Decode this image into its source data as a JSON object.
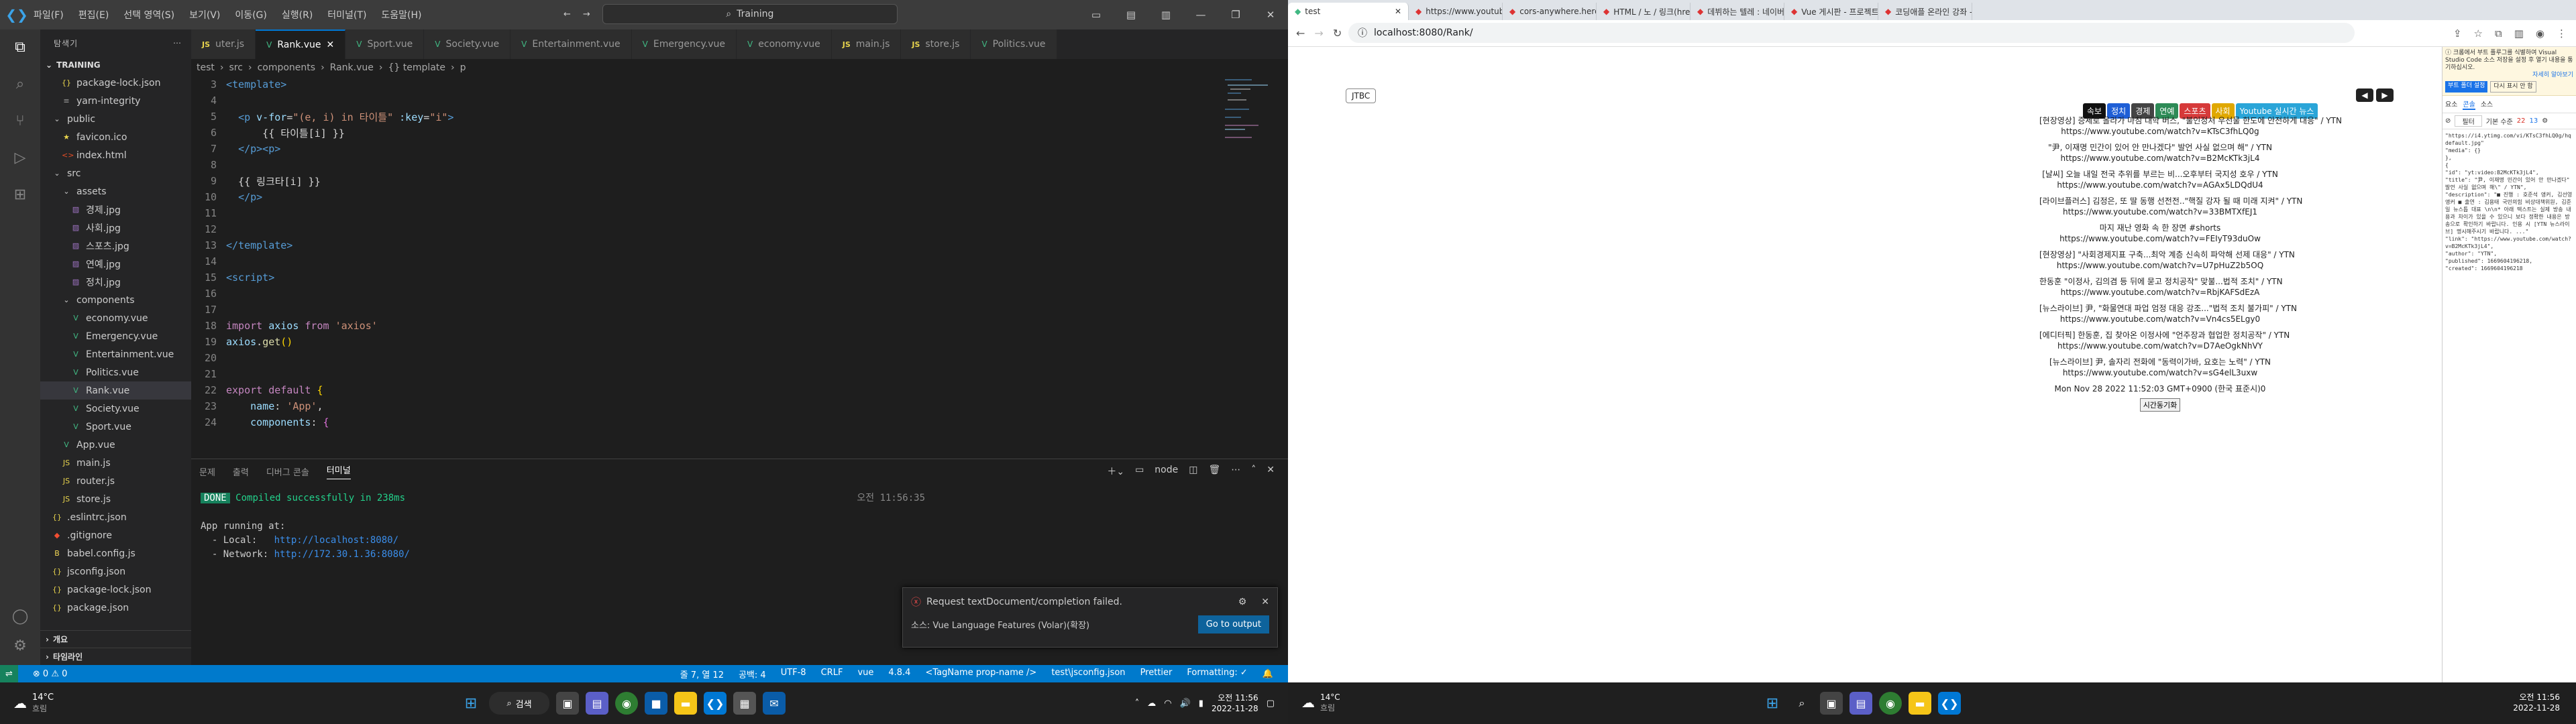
{
  "vscode": {
    "menu": [
      "파일(F)",
      "편집(E)",
      "선택 영역(S)",
      "보기(V)",
      "이동(G)",
      "실행(R)",
      "터미널(T)",
      "도움말(H)"
    ],
    "search_text": "Training",
    "sidebar": {
      "title": "탐색기",
      "section": "TRAINING",
      "items": [
        {
          "label": "package-lock.json",
          "icon": "json",
          "depth": 1
        },
        {
          "label": "yarn-integrity",
          "icon": "file",
          "depth": 1
        },
        {
          "label": "public",
          "icon": "folder",
          "depth": 0
        },
        {
          "label": "favicon.ico",
          "icon": "star",
          "depth": 1
        },
        {
          "label": "index.html",
          "icon": "html",
          "depth": 1
        },
        {
          "label": "src",
          "icon": "folder",
          "depth": 0
        },
        {
          "label": "assets",
          "icon": "folder",
          "depth": 1
        },
        {
          "label": "경제.jpg",
          "icon": "img",
          "depth": 2
        },
        {
          "label": "사회.jpg",
          "icon": "img",
          "depth": 2
        },
        {
          "label": "스포츠.jpg",
          "icon": "img",
          "depth": 2
        },
        {
          "label": "연예.jpg",
          "icon": "img",
          "depth": 2
        },
        {
          "label": "정치.jpg",
          "icon": "img",
          "depth": 2
        },
        {
          "label": "components",
          "icon": "folder",
          "depth": 1
        },
        {
          "label": "economy.vue",
          "icon": "vue",
          "depth": 2
        },
        {
          "label": "Emergency.vue",
          "icon": "vue",
          "depth": 2
        },
        {
          "label": "Entertainment.vue",
          "icon": "vue",
          "depth": 2
        },
        {
          "label": "Politics.vue",
          "icon": "vue",
          "depth": 2
        },
        {
          "label": "Rank.vue",
          "icon": "vue",
          "depth": 2,
          "selected": true
        },
        {
          "label": "Society.vue",
          "icon": "vue",
          "depth": 2
        },
        {
          "label": "Sport.vue",
          "icon": "vue",
          "depth": 2
        },
        {
          "label": "App.vue",
          "icon": "vue",
          "depth": 1
        },
        {
          "label": "main.js",
          "icon": "js",
          "depth": 1
        },
        {
          "label": "router.js",
          "icon": "js",
          "depth": 1
        },
        {
          "label": "store.js",
          "icon": "js",
          "depth": 1
        },
        {
          "label": ".eslintrc.json",
          "icon": "json",
          "depth": 0
        },
        {
          "label": ".gitignore",
          "icon": "git",
          "depth": 0
        },
        {
          "label": "babel.config.js",
          "icon": "babel",
          "depth": 0
        },
        {
          "label": "jsconfig.json",
          "icon": "json",
          "depth": 0
        },
        {
          "label": "package-lock.json",
          "icon": "json",
          "depth": 0
        },
        {
          "label": "package.json",
          "icon": "json",
          "depth": 0
        }
      ],
      "outline": "개요",
      "timeline": "타임라인"
    },
    "tabs": [
      {
        "label": "uter.js",
        "icon": "js"
      },
      {
        "label": "Rank.vue",
        "icon": "vue",
        "active": true
      },
      {
        "label": "Sport.vue",
        "icon": "vue"
      },
      {
        "label": "Society.vue",
        "icon": "vue"
      },
      {
        "label": "Entertainment.vue",
        "icon": "vue"
      },
      {
        "label": "Emergency.vue",
        "icon": "vue"
      },
      {
        "label": "economy.vue",
        "icon": "vue"
      },
      {
        "label": "main.js",
        "icon": "js"
      },
      {
        "label": "store.js",
        "icon": "js"
      },
      {
        "label": "Politics.vue",
        "icon": "vue"
      }
    ],
    "breadcrumb": [
      "test",
      "src",
      "components",
      "Rank.vue",
      "{} template",
      "p"
    ],
    "code_lines": [
      {
        "n": "3",
        "tokens": [
          [
            "tg",
            "<template>"
          ]
        ]
      },
      {
        "n": "4",
        "tokens": []
      },
      {
        "n": "5",
        "tokens": [
          [
            "",
            "  "
          ],
          [
            "tg",
            "<p "
          ],
          [
            "at",
            "v-for"
          ],
          [
            "",
            "="
          ],
          [
            "st",
            "\"(e, i) in 타이틀\" "
          ],
          [
            "at",
            ":key"
          ],
          [
            "",
            "="
          ],
          [
            "st",
            "\"i\""
          ],
          [
            "tg",
            ">"
          ]
        ]
      },
      {
        "n": "6",
        "tokens": [
          [
            "",
            "      {{ 타이틀[i] }}"
          ]
        ]
      },
      {
        "n": "7",
        "tokens": [
          [
            "",
            "  "
          ],
          [
            "tg",
            "</p><p>"
          ]
        ]
      },
      {
        "n": "8",
        "tokens": []
      },
      {
        "n": "9",
        "tokens": [
          [
            "",
            "  {{ 링크타[i] }}"
          ]
        ]
      },
      {
        "n": "10",
        "tokens": [
          [
            "",
            "  "
          ],
          [
            "tg",
            "</p>"
          ]
        ]
      },
      {
        "n": "11",
        "tokens": []
      },
      {
        "n": "12",
        "tokens": []
      },
      {
        "n": "13",
        "tokens": [
          [
            "tg",
            "</template>"
          ]
        ]
      },
      {
        "n": "14",
        "tokens": []
      },
      {
        "n": "15",
        "tokens": [
          [
            "tg",
            "<script>"
          ]
        ]
      },
      {
        "n": "16",
        "tokens": []
      },
      {
        "n": "17",
        "tokens": []
      },
      {
        "n": "18",
        "tokens": [
          [
            "kw",
            "import "
          ],
          [
            "at",
            "axios "
          ],
          [
            "kw",
            "from "
          ],
          [
            "st",
            "'axios'"
          ]
        ]
      },
      {
        "n": "19",
        "tokens": [
          [
            "at",
            "axios"
          ],
          [
            "",
            "."
          ],
          [
            "yl",
            "get"
          ],
          [
            "br",
            "()"
          ]
        ]
      },
      {
        "n": "20",
        "tokens": []
      },
      {
        "n": "21",
        "tokens": []
      },
      {
        "n": "22",
        "tokens": [
          [
            "kw",
            "export default "
          ],
          [
            "br",
            "{"
          ]
        ]
      },
      {
        "n": "23",
        "tokens": [
          [
            "at",
            "    name"
          ],
          [
            "",
            ": "
          ],
          [
            "st",
            "'App'"
          ],
          [
            "",
            ","
          ]
        ]
      },
      {
        "n": "24",
        "tokens": [
          [
            "at",
            "    components"
          ],
          [
            "",
            ": "
          ],
          [
            "pu",
            "{"
          ]
        ]
      }
    ],
    "panel_tabs": [
      "문제",
      "출력",
      "디버그 콘솔",
      "터미널"
    ],
    "panel_active": "터미널",
    "panel_right": "node",
    "terminal": {
      "done_badge": "DONE",
      "compiled": "Compiled successfully in 238ms",
      "time": "오전 11:56:35",
      "running": "App running at:",
      "local_label": "  - Local:   ",
      "local_url": "http://localhost:8080/",
      "network_label": "  - Network: ",
      "network_url": "http://172.30.1.36:8080/"
    },
    "notification": {
      "message": "Request textDocument/completion failed.",
      "source": "소스: Vue Language Features (Volar)(확장)",
      "button": "Go to output"
    },
    "statusbar": {
      "left": [
        "⊗ 0 ⚠ 0"
      ],
      "right": [
        "줄 7, 열 12",
        "공백: 4",
        "UTF-8",
        "CRLF",
        "vue",
        "4.8.4",
        "<TagName prop-name />",
        "test\\jsconfig.json",
        "Prettier",
        "Formatting: ✓"
      ]
    }
  },
  "taskbar1": {
    "weather_temp": "14°C",
    "weather_desc": "흐림",
    "search": "검색",
    "time": "오전 11:56",
    "date": "2022-11-28"
  },
  "browser": {
    "tabs": [
      {
        "label": "test",
        "active": true
      },
      {
        "label": "https://www.youtube.com/feed/..."
      },
      {
        "label": "cors-anywhere.herokuapp.com"
      },
      {
        "label": "HTML / 노 / 링크(href) 만들기 - 선..."
      },
      {
        "label": "데뷔하는 텔레 : 네이버 통합검색"
      },
      {
        "label": "Vue 게시판 - 프로젝트 준비 (1..."
      },
      {
        "label": "코딩애플 온라인 강좌 - 개발자..."
      }
    ],
    "url": "localhost:8080/Rank/",
    "jtbc": "JTBC",
    "categories": [
      {
        "label": "속보",
        "color": "#111111"
      },
      {
        "label": "정치",
        "color": "#1f5fd6"
      },
      {
        "label": "경제",
        "color": "#444444"
      },
      {
        "label": "연예",
        "color": "#2e8b57"
      },
      {
        "label": "스포츠",
        "color": "#d63a3a"
      },
      {
        "label": "사회",
        "color": "#e0a800"
      },
      {
        "label": "Youtube 실시간 뉴스",
        "color": "#2aa5d8"
      }
    ],
    "items": [
      "[현장영상] 증세로 올라가 마침 대학 버스, \"불인정처 우선물 한도에 안전하게 대응\" / YTN",
      "https://www.youtube.com/watch?v=KTsC3fhLQ0g",
      "\"尹, 이재명 민간이 있어 안 만나겠다\" 발언 사실 없으며 해\" / YTN",
      "https://www.youtube.com/watch?v=B2McKTk3jL4",
      "[날씨] 오늘 내일 전국 추위를 부르는 비...오후부터 국지성 호우 / YTN",
      "https://www.youtube.com/watch?v=AGAx5LDQdU4",
      "[라이브플러스] 김정은, 또 딸 동행 선전전..\"핵질 강자 될 때 미래 지켜\" / YTN",
      "https://www.youtube.com/watch?v=33BMTXfEJ1",
      "마지 재난 영화 속 한 장면 #shorts",
      "https://www.youtube.com/watch?v=FEIyT93duOw",
      "[현장영상] \"사회경제지표 구축...최악 계층 신속히 파악해 선제 대응\" / YTN",
      "https://www.youtube.com/watch?v=U7pHuZ2b5OQ",
      "한동훈 \"이정사, 김의겸 등 뒤에 묻고 정치공작\" 맞불...법적 조치\" / YTN",
      "https://www.youtube.com/watch?v=RbjKAFSdEzA",
      "[뉴스라이브] 尹, \"화물연대 파업 엄정 대응 강조...\"법적 조치 불가피\" / YTN",
      "https://www.youtube.com/watch?v=Vn4cs5ELgy0",
      "[에디터픽] 한동훈, 집 찾아온 이정사에 \"언주장과 협업한 정치공작\" / YTN",
      "https://www.youtube.com/watch?v=D7AeOgkNhVY",
      "[뉴스라이브] 尹, 솔자리 전화에 \"동력이가바, 요호는 노력\" / YTN",
      "https://www.youtube.com/watch?v=sG4elL3uxw"
    ],
    "timestamp": "Mon Nov 28 2022 11:52:03 GMT+0900 (한국 표준시)0",
    "button": "시간동기화",
    "devtools": {
      "banner": "크롬에서 부트 플루그를 식별하여 Visual Studio Code 소스 저장을 설정 후 열기 내용을 통기하십시오.",
      "banner_link": "자세히 알아보기",
      "banner_btn1": "부트 폴더 설정",
      "banner_btn2": "다시 표시 안 함",
      "tabs": [
        "요소",
        "콘솔",
        "소스"
      ],
      "active_tab": "콘솔",
      "filter": "필터",
      "level": "기본 수준",
      "counts": [
        "22",
        "13"
      ],
      "console_lines": [
        "\"https://i4.ytimg.com/vi/KTsC3fhLQ0g/hqdefault.jpg\"",
        "\"media\": {}",
        "},",
        "{",
        "\"id\": \"yt:video:B2McKTk3jL4\",",
        "\"title\": \"尹, 이재명 민간이 있어 안 만나겠다\" 발언 사실 없으며 해\\\" / YTN\",",
        "\"description\": \"■ 진행 : 호준석 앵커, 김선영 앵커 ■ 출연 : 김용태 국민의힘 비상대책위원, 김준일 뉴스톱 대표 \\n\\n* 아래 텍스트는 실제 방송 내용과 차이가 있을 수 있으니 보다 정확한 내용은 방송으로 확인하기 바랍니다. 인용 시 [YTN 뉴스라이브] 명시해주시기 바랍니다. ...\"",
        "\"link\": \"https://www.youtube.com/watch?v=B2McKTk3jL4\",",
        "\"author\": \"YTN\",",
        "\"published\": 1669604196218,",
        "\"created\": 1669604196218"
      ]
    }
  },
  "taskbar2": {
    "weather_temp": "14°C",
    "weather_desc": "흐림",
    "time": "오전 11:56",
    "date": "2022-11-28"
  }
}
